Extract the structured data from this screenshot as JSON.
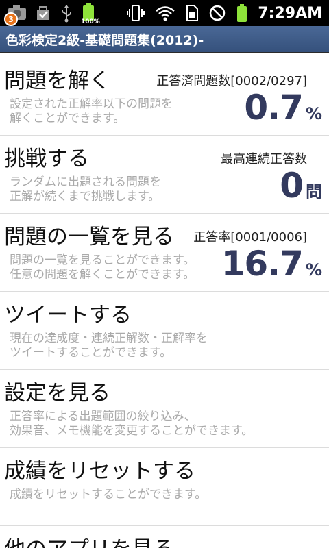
{
  "status_bar": {
    "notification_count": "3",
    "battery_left_label": "100%",
    "clock": "7:29AM"
  },
  "app": {
    "title": "色彩検定2級-基礎問題集(2012)-"
  },
  "menu": [
    {
      "title": "問題を解く",
      "desc_line1": "設定された正解率以下の問題を",
      "desc_line2": "解くことができます。",
      "stat_label": "正答済問題数[0002/0297]",
      "stat_value": "0.7",
      "stat_unit": "%"
    },
    {
      "title": "挑戦する",
      "desc_line1": "ランダムに出題される問題を",
      "desc_line2": "正解が続くまで挑戦します。",
      "stat_label": "最高連続正答数",
      "stat_value": "0",
      "stat_unit": "問"
    },
    {
      "title": "問題の一覧を見る",
      "desc_line1": "問題の一覧を見ることができます。",
      "desc_line2": "任意の問題を解くことができます。",
      "stat_label": "正答率[0001/0006]",
      "stat_value": "16.7",
      "stat_unit": "%"
    },
    {
      "title": "ツイートする",
      "desc_line1": "現在の達成度・連続正解数・正解率を",
      "desc_line2": "ツイートすることができます。"
    },
    {
      "title": "設定を見る",
      "desc_line1": "正答率による出題範囲の絞り込み、",
      "desc_line2": "効果音、メモ機能を変更することができます。"
    },
    {
      "title": "成績をリセットする",
      "desc_line1": "成績をリセットすることができます。"
    },
    {
      "title": "他のアプリを見る"
    }
  ],
  "colors": {
    "title_bar": "#3f5d8a",
    "stat_value": "#333a5e",
    "description": "#aaaaaa",
    "battery_green": "#8ee23a"
  }
}
